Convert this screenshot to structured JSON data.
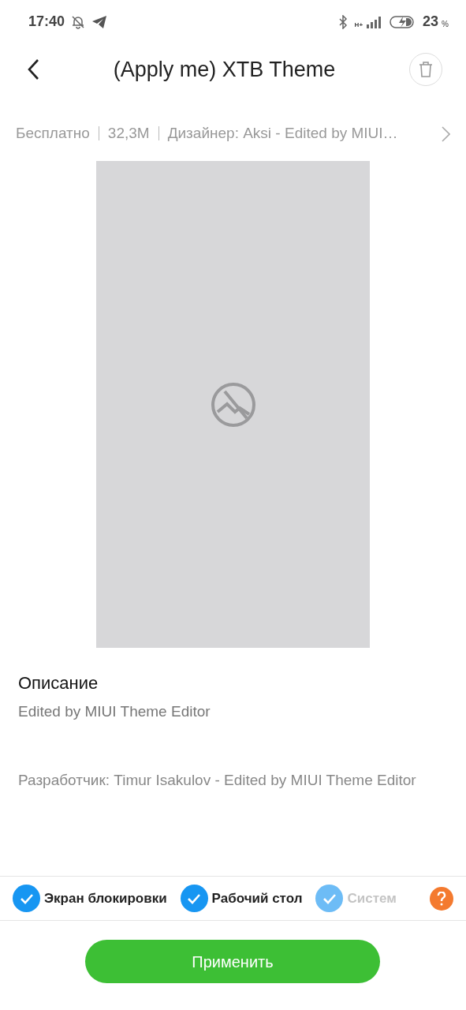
{
  "status_bar": {
    "time": "17:40",
    "battery": "23",
    "battery_unit": "%",
    "network": "H+"
  },
  "header": {
    "title": "(Apply me) XTB Theme"
  },
  "meta": [
    "Бесплатно",
    "32,3M",
    "Дизайнер: Aksi - Edited by MIUI…"
  ],
  "description": {
    "heading": "Описание",
    "text": "Edited by MIUI Theme Editor"
  },
  "developer": "Разработчик: Timur Isakulov - Edited by MIUI Theme Editor",
  "components": [
    {
      "label": "Экран блокировки",
      "checked": true,
      "faded": false
    },
    {
      "label": "Рабочий стол",
      "checked": true,
      "faded": false
    },
    {
      "label": "Систем",
      "checked": true,
      "faded": true
    }
  ],
  "apply_button": "Применить"
}
